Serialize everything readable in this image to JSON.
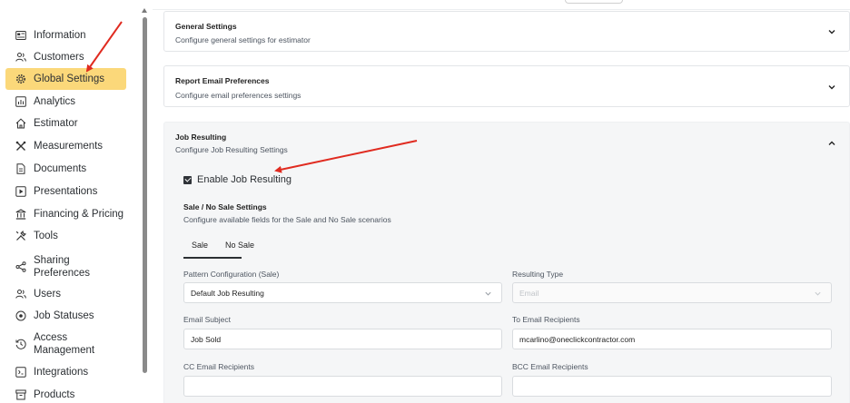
{
  "sidebar": {
    "items": [
      {
        "label": "Information",
        "icon": "id-card-icon",
        "active": false
      },
      {
        "label": "Customers",
        "icon": "users-icon",
        "active": false
      },
      {
        "label": "Global Settings",
        "icon": "gear-icon",
        "active": true
      },
      {
        "label": "Analytics",
        "icon": "chart-icon",
        "active": false
      },
      {
        "label": "Estimator",
        "icon": "home-icon",
        "active": false
      },
      {
        "label": "Measurements",
        "icon": "tools-cross-icon",
        "active": false
      },
      {
        "label": "Documents",
        "icon": "document-icon",
        "active": false
      },
      {
        "label": "Presentations",
        "icon": "play-icon",
        "active": false
      },
      {
        "label": "Financing & Pricing",
        "icon": "bank-icon",
        "active": false
      },
      {
        "label": "Tools",
        "icon": "wrench-icon",
        "active": false
      },
      {
        "label": "Sharing Preferences",
        "icon": "share-icon",
        "active": false
      },
      {
        "label": "Users",
        "icon": "users-icon",
        "active": false
      },
      {
        "label": "Job Statuses",
        "icon": "target-icon",
        "active": false
      },
      {
        "label": "Access Management",
        "icon": "history-icon",
        "active": false
      },
      {
        "label": "Integrations",
        "icon": "plug-icon",
        "active": false
      },
      {
        "label": "Products",
        "icon": "archive-icon",
        "active": false
      }
    ],
    "active_color": "#fbd87a"
  },
  "cards": {
    "general": {
      "title": "General Settings",
      "subtitle": "Configure general settings for estimator"
    },
    "report": {
      "title": "Report Email Preferences",
      "subtitle": "Configure email preferences settings"
    },
    "job": {
      "title": "Job Resulting",
      "subtitle": "Configure Job Resulting Settings"
    }
  },
  "job_resulting": {
    "enable_label": "Enable Job Resulting",
    "enabled": true,
    "section_title": "Sale / No Sale Settings",
    "section_subtitle": "Configure available fields for the Sale and No Sale scenarios",
    "tabs": [
      "Sale",
      "No Sale"
    ],
    "active_tab": "Sale",
    "fields": {
      "pattern_label": "Pattern Configuration (Sale)",
      "pattern_value": "Default Job Resulting",
      "resulting_type_label": "Resulting Type",
      "resulting_type_value": "Email",
      "email_subject_label": "Email Subject",
      "email_subject_value": "Job Sold",
      "to_label": "To Email Recipients",
      "to_value": "mcarlino@oneclickcontractor.com",
      "cc_label": "CC Email Recipients",
      "cc_value": "",
      "bcc_label": "BCC Email Recipients",
      "bcc_value": ""
    }
  },
  "annotation_color": "#e02b20"
}
